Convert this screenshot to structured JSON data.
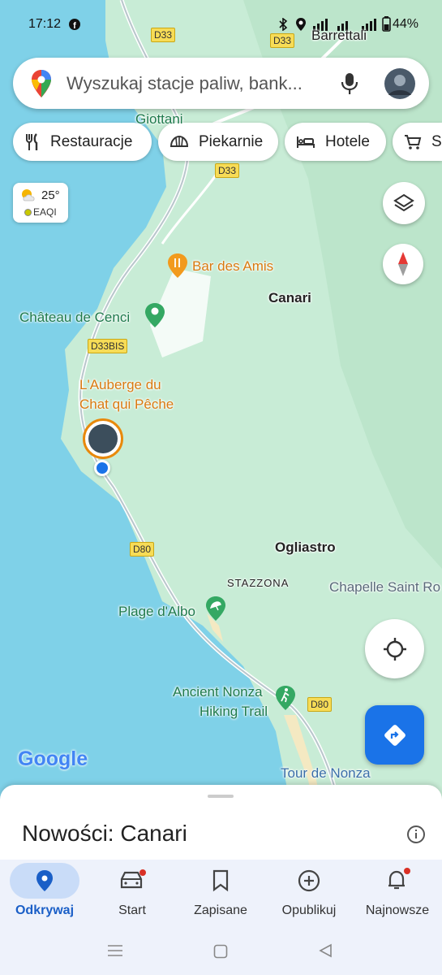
{
  "status_bar": {
    "time": "17:12",
    "battery": "44%"
  },
  "search": {
    "placeholder": "Wyszukaj stacje paliw, bank..."
  },
  "chips": [
    {
      "label": "Restauracje",
      "icon": "restaurant-icon"
    },
    {
      "label": "Piekarnie",
      "icon": "bakery-icon"
    },
    {
      "label": "Hotele",
      "icon": "hotel-icon"
    },
    {
      "label": "Sp",
      "icon": "shopping-cart-icon"
    }
  ],
  "weather": {
    "temperature": "25°",
    "aqi_label": "EAQI"
  },
  "map_labels": {
    "barrettali": "Barrettali",
    "giottani": "Giottani",
    "bar_des_amis": "Bar des Amis",
    "canari": "Canari",
    "chateau": "Château de Cenci",
    "auberge_line1": "L'Auberge du",
    "auberge_line2": "Chat qui Pêche",
    "ogliastro": "Ogliastro",
    "stazzona": "STAZZONA",
    "chapelle": "Chapelle Saint Ro",
    "plage": "Plage d'Albo",
    "hiking_line1": "Ancient Nonza",
    "hiking_line2": "Hiking Trail",
    "tour": "Tour de Nonza",
    "google": "Google"
  },
  "road_shields": {
    "d33_a": "D33",
    "d33_b": "D33",
    "d33_c": "D33",
    "d33bis": "D33BIS",
    "d80_a": "D80",
    "d80_b": "D80"
  },
  "sheet": {
    "title": "Nowości: Canari"
  },
  "bottom_nav": [
    {
      "label": "Odkrywaj",
      "icon": "explore-pin-icon",
      "active": true
    },
    {
      "label": "Start",
      "icon": "car-icon",
      "badge": true
    },
    {
      "label": "Zapisane",
      "icon": "bookmark-icon"
    },
    {
      "label": "Opublikuj",
      "icon": "add-circle-icon"
    },
    {
      "label": "Najnowsze",
      "icon": "bell-icon",
      "badge": true
    }
  ],
  "colors": {
    "water": "#7fd1e8",
    "land": "#c8ecd6",
    "accent": "#1a73e8",
    "active_tab": "#c9dcf8"
  }
}
